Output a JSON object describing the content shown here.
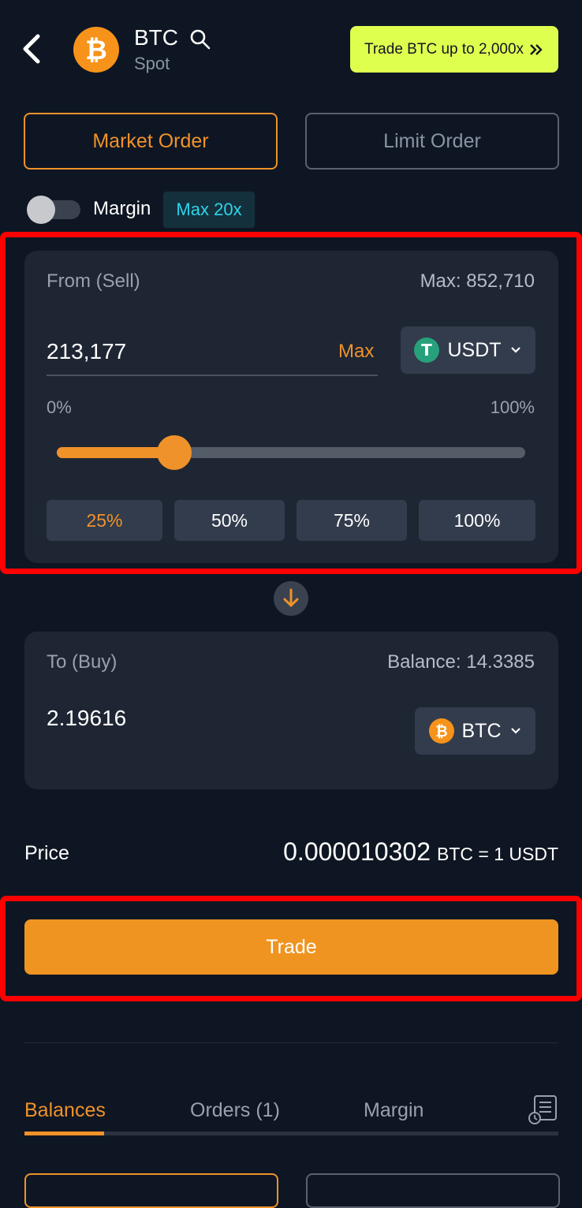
{
  "header": {
    "title": "BTC",
    "subtitle": "Spot",
    "coin_symbol": "₿",
    "promo_label": "Trade BTC up to 2,000x",
    "promo_icon": "double-chevron-right-icon"
  },
  "order_tabs": {
    "market": "Market Order",
    "limit": "Limit Order",
    "active": "market"
  },
  "margin": {
    "label": "Margin",
    "enabled": false,
    "badge": "Max 20x"
  },
  "from": {
    "label": "From (Sell)",
    "max_text": "Max: 852,710",
    "amount": "213,177",
    "max_link": "Max",
    "token": "USDT",
    "token_symbol": "T",
    "min_label": "0%",
    "max_label": "100%",
    "slider_fraction": 0.25,
    "percent_buttons": [
      "25%",
      "50%",
      "75%",
      "100%"
    ],
    "active_percent_index": 0
  },
  "to": {
    "label": "To (Buy)",
    "balance_text": "Balance: 14.3385",
    "amount": "2.19616",
    "token": "BTC",
    "token_symbol": "₿"
  },
  "price": {
    "label": "Price",
    "value": "0.000010302",
    "unit": "BTC = 1 USDT"
  },
  "trade_button": "Trade",
  "bottom_tabs": [
    "Balances",
    "Orders (1)",
    "Margin"
  ],
  "colors": {
    "background": "#0f1623",
    "card": "#1e2634",
    "accent": "#f0922a",
    "promo": "#dfff4f",
    "cyan": "#2ed4ea",
    "tether": "#26a17b",
    "bitcoin": "#f7931a",
    "highlight": "#ff0000"
  }
}
